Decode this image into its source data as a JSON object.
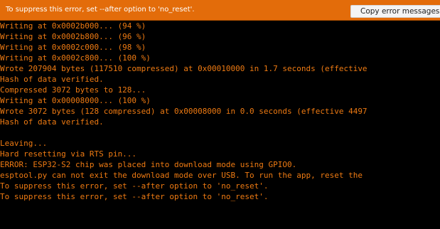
{
  "error_bar": {
    "message": "To suppress this error, set --after option to 'no_reset'.",
    "copy_button_label": "Copy error messages"
  },
  "console": {
    "lines": [
      "Writing at 0x0002b000... (94 %)",
      "Writing at 0x0002b800... (96 %)",
      "Writing at 0x0002c000... (98 %)",
      "Writing at 0x0002c800... (100 %)",
      "Wrote 207904 bytes (117510 compressed) at 0x00010000 in 1.7 seconds (effective",
      "Hash of data verified.",
      "Compressed 3072 bytes to 128...",
      "Writing at 0x00008000... (100 %)",
      "Wrote 3072 bytes (128 compressed) at 0x00008000 in 0.0 seconds (effective 4497",
      "Hash of data verified.",
      "",
      "Leaving...",
      "Hard resetting via RTS pin...",
      "ERROR: ESP32-S2 chip was placed into download mode using GPIO0.",
      "esptool.py can not exit the download mode over USB. To run the app, reset the",
      "To suppress this error, set --after option to 'no_reset'.",
      "To suppress this error, set --after option to 'no_reset'."
    ]
  },
  "colors": {
    "console_background": "#000000",
    "console_text": "#ee7a12",
    "error_bar_background": "#e36c0a",
    "error_bar_text": "#ffffff",
    "button_background": "#f4f4f4"
  }
}
